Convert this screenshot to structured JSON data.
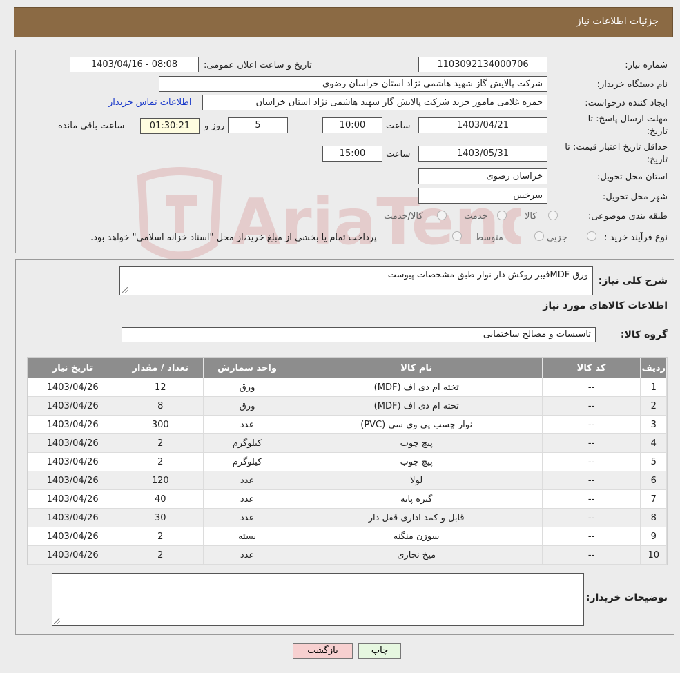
{
  "header": {
    "title": "جزئیات اطلاعات نیاز"
  },
  "info": {
    "need_number_label": "شماره نیاز:",
    "need_number": "1103092134000706",
    "announce_label": "تاریخ و ساعت اعلان عمومی:",
    "announce_value": "1403/04/16 - 08:08",
    "buyer_org_label": "نام دستگاه خریدار:",
    "buyer_org": "شرکت پالایش گاز شهید هاشمی نژاد   استان خراسان رضوی",
    "creator_label": "ایجاد کننده درخواست:",
    "creator": "حمزه غلامی مامور خرید شرکت پالایش گاز شهید هاشمی نژاد   استان خراسان",
    "contact_link": "اطلاعات تماس خریدار",
    "deadline_label_1": "مهلت ارسال پاسخ: تا",
    "deadline_label_2": "تاریخ:",
    "deadline_date": "1403/04/21",
    "hour_label": "ساعت",
    "deadline_time": "10:00",
    "days_value": "5",
    "days_label": "روز و",
    "remaining_time": "01:30:21",
    "remaining_label": "ساعت باقی مانده",
    "validity_label_1": "حداقل تاریخ اعتبار قیمت: تا",
    "validity_label_2": "تاریخ:",
    "validity_date": "1403/05/31",
    "validity_time": "15:00",
    "province_label": "استان محل تحویل:",
    "province": "خراسان رضوی",
    "city_label": "شهر محل تحویل:",
    "city": "سرخس",
    "category_label": "طبقه بندی موضوعی:",
    "category_options": [
      "کالا",
      "خدمت",
      "کالا/خدمت"
    ],
    "process_label": "نوع فرآیند خرید :",
    "process_options": [
      "جزیی",
      "متوسط"
    ],
    "process_note": "پرداخت تمام یا بخشی از مبلغ خرید،از محل \"اسناد خزانه اسلامی\" خواهد بود."
  },
  "description": {
    "label": "شرح کلی نیاز:",
    "text": "ورق MDFفیبر روکش دار نوار طبق مشخصات پیوست"
  },
  "goods": {
    "section_title": "اطلاعات کالاهای مورد نیاز",
    "group_label": "گروه کالا:",
    "group_value": "تاسیسات و مصالح ساختمانی",
    "columns": [
      "ردیف",
      "کد کالا",
      "نام کالا",
      "واحد شمارش",
      "تعداد / مقدار",
      "تاریخ نیاز"
    ],
    "rows": [
      [
        "1",
        "--",
        "تخته ام دی اف (MDF)",
        "ورق",
        "12",
        "1403/04/26"
      ],
      [
        "2",
        "--",
        "تخته ام دی اف (MDF)",
        "ورق",
        "8",
        "1403/04/26"
      ],
      [
        "3",
        "--",
        "نوار چسب پی وی سی (PVC)",
        "عدد",
        "300",
        "1403/04/26"
      ],
      [
        "4",
        "--",
        "پیچ چوب",
        "کیلوگرم",
        "2",
        "1403/04/26"
      ],
      [
        "5",
        "--",
        "پیچ چوب",
        "کیلوگرم",
        "2",
        "1403/04/26"
      ],
      [
        "6",
        "--",
        "لولا",
        "عدد",
        "120",
        "1403/04/26"
      ],
      [
        "7",
        "--",
        "گیره پایه",
        "عدد",
        "40",
        "1403/04/26"
      ],
      [
        "8",
        "--",
        "قابل و کمد اداری قفل دار",
        "عدد",
        "30",
        "1403/04/26"
      ],
      [
        "9",
        "--",
        "سوزن منگنه",
        "بسته",
        "2",
        "1403/04/26"
      ],
      [
        "10",
        "--",
        "میخ نجاری",
        "عدد",
        "2",
        "1403/04/26"
      ]
    ]
  },
  "buyer_notes": {
    "label": "توضیحات خریدار:",
    "text": ""
  },
  "buttons": {
    "print": "چاپ",
    "back": "بازگشت"
  },
  "watermark": {
    "text": "AriaTender.neT"
  },
  "colors": {
    "header": "#8b6a44",
    "link": "#1a39c9",
    "table_header": "#8d8d8d",
    "back_button": "#f7d0d0",
    "print_button": "#e6f7e0"
  }
}
